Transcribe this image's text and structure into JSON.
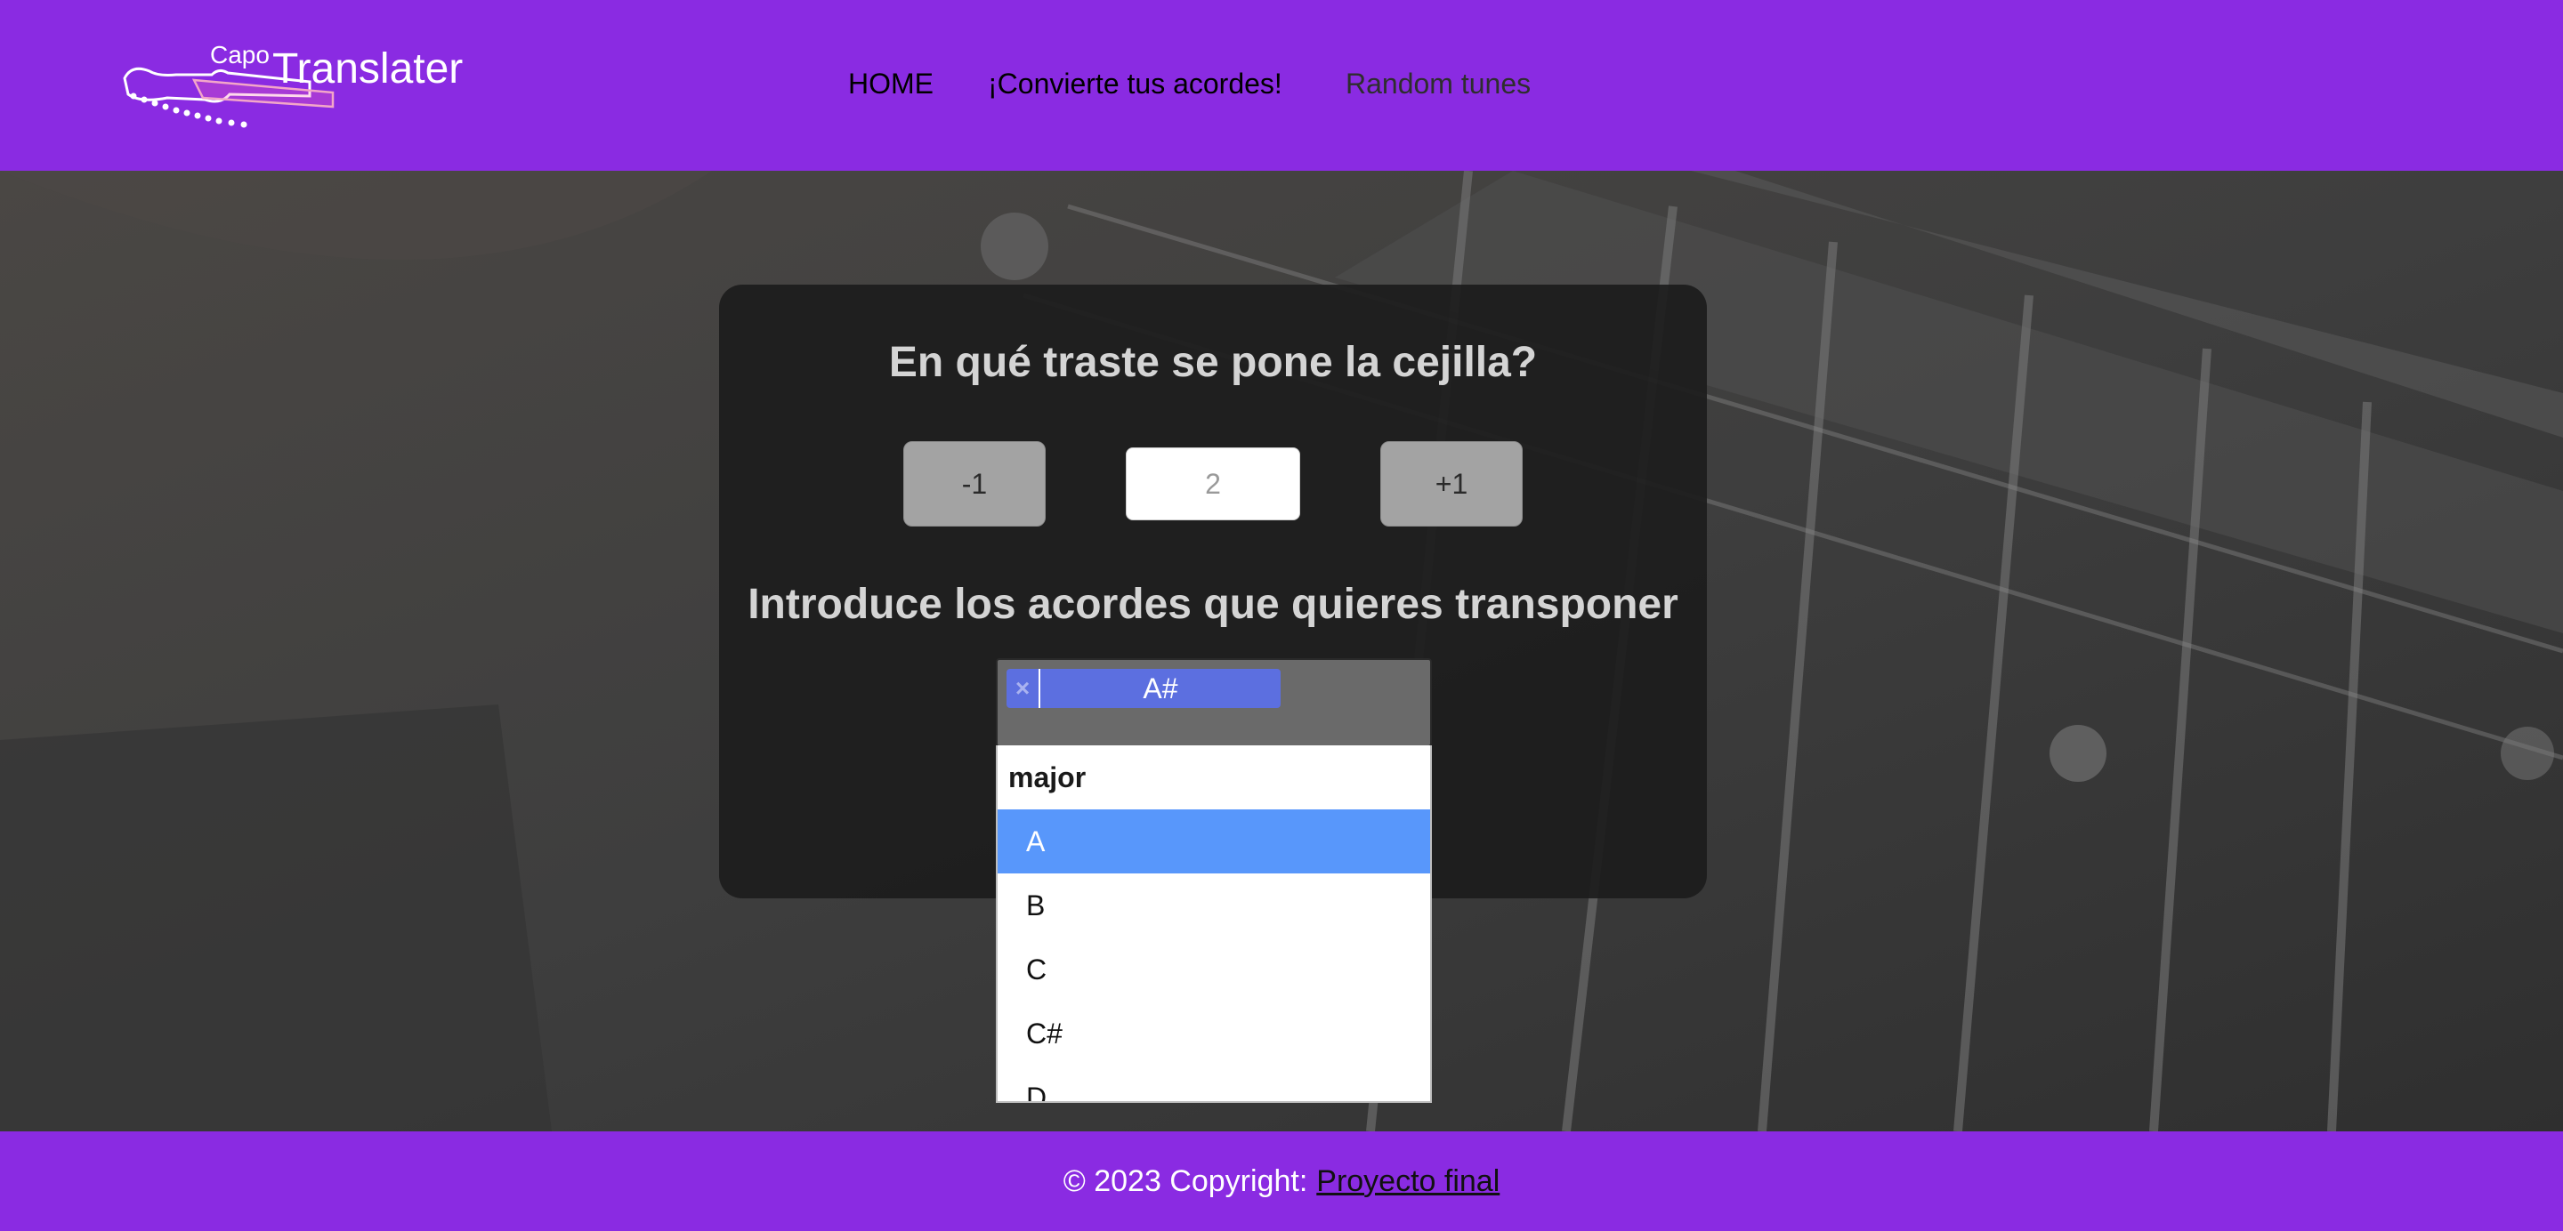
{
  "header": {
    "logo": {
      "small": "Capo",
      "large": "Translater"
    },
    "nav": [
      {
        "label": "HOME"
      },
      {
        "label": "¡Convierte tus acordes!"
      },
      {
        "label": "Random tunes"
      }
    ]
  },
  "card": {
    "fret_title": "En qué traste se pone la cejilla?",
    "minus_label": "-1",
    "fret_value": "2",
    "plus_label": "+1",
    "chords_title": "Introduce los acordes que quieres transponer"
  },
  "chord_select": {
    "selected": [
      {
        "remove": "×",
        "label": "A#"
      }
    ],
    "group_label": "major",
    "options": [
      {
        "label": "A",
        "highlighted": true
      },
      {
        "label": "B"
      },
      {
        "label": "C"
      },
      {
        "label": "C#"
      },
      {
        "label": "D"
      }
    ]
  },
  "footer": {
    "text": "© 2023 Copyright:",
    "link": "Proyecto final"
  },
  "colors": {
    "brand": "#8a2be2",
    "highlight": "#5897fb",
    "chip": "#5c6fe0"
  }
}
